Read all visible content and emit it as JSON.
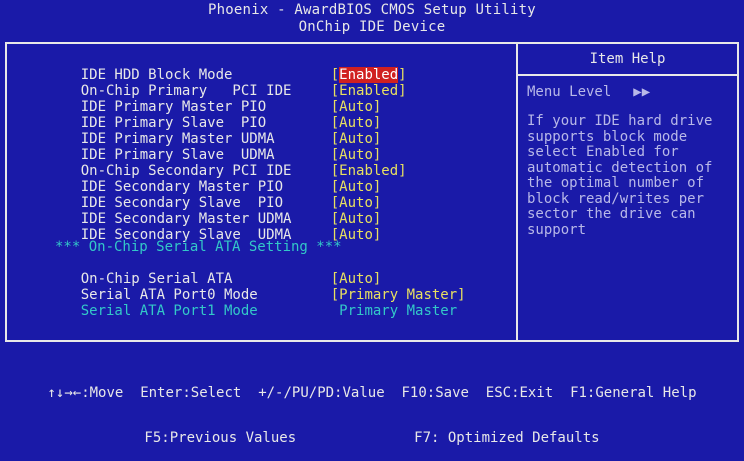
{
  "header": {
    "title_line1": "Phoenix - AwardBIOS CMOS Setup Utility",
    "title_line2": "OnChip IDE Device"
  },
  "settings": [
    {
      "label": "IDE HDD Block Mode",
      "value": "Enabled"
    },
    {
      "label": "On-Chip Primary   PCI IDE",
      "value": "Enabled"
    },
    {
      "label": "IDE Primary Master PIO",
      "value": "Auto"
    },
    {
      "label": "IDE Primary Slave  PIO",
      "value": "Auto"
    },
    {
      "label": "IDE Primary Master UDMA",
      "value": "Auto"
    },
    {
      "label": "IDE Primary Slave  UDMA",
      "value": "Auto"
    },
    {
      "label": "On-Chip Secondary PCI IDE",
      "value": "Enabled"
    },
    {
      "label": "IDE Secondary Master PIO",
      "value": "Auto"
    },
    {
      "label": "IDE Secondary Slave  PIO",
      "value": "Auto"
    },
    {
      "label": "IDE Secondary Master UDMA",
      "value": "Auto"
    },
    {
      "label": "IDE Secondary Slave  UDMA",
      "value": "Auto"
    }
  ],
  "section_heading": "*** On-Chip Serial ATA Setting ***",
  "sata_settings": [
    {
      "label": "On-Chip Serial ATA",
      "value": "Auto"
    },
    {
      "label": "Serial ATA Port0 Mode",
      "value": "Primary Master"
    },
    {
      "label": "Serial ATA Port1 Mode",
      "value": "Primary Master"
    }
  ],
  "help": {
    "title": "Item Help",
    "menu_level_label": "Menu Level",
    "menu_level_arrows": "▶▶",
    "text": "If your IDE hard drive\nsupports block mode\nselect Enabled for\nautomatic detection of\nthe optimal number of\nblock read/writes per\nsector the drive can\nsupport"
  },
  "footer": {
    "line1": "↑↓→←:Move  Enter:Select  +/-/PU/PD:Value  F10:Save  ESC:Exit  F1:General Help",
    "line2": "F5:Previous Values              F7: Optimized Defaults"
  },
  "colors": {
    "background": "#1a1aa8",
    "value": "#e8e060",
    "highlight": "#d02020",
    "disabled": "#33c8c8"
  }
}
